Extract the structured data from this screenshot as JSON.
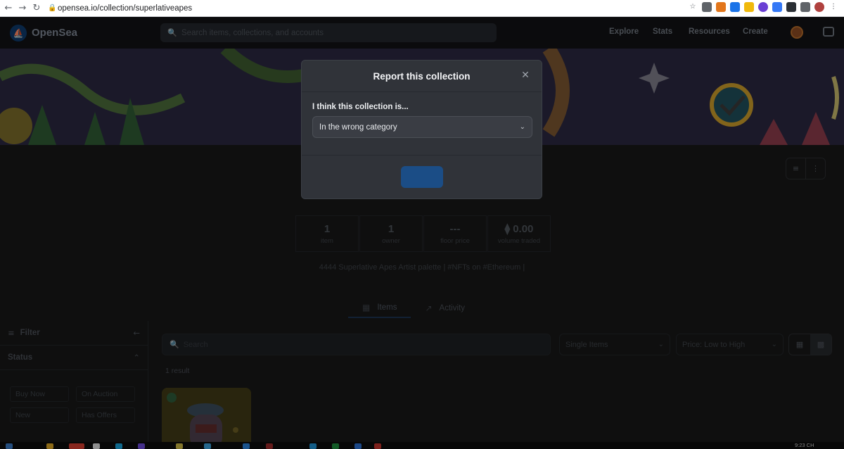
{
  "browser": {
    "url": "opensea.io/collection/superlativeapes",
    "back_glyph": "←",
    "forward_glyph": "→",
    "reload_glyph": "↻",
    "lock_glyph": "🔒",
    "star_glyph": "☆"
  },
  "header": {
    "brand": "OpenSea",
    "search_placeholder": "Search items, collections, and accounts",
    "nav": [
      "Explore",
      "Stats",
      "Resources",
      "Create"
    ]
  },
  "collection": {
    "stats": [
      {
        "value": "1",
        "label": "item"
      },
      {
        "value": "1",
        "label": "owner"
      },
      {
        "value": "---",
        "label": "floor price"
      },
      {
        "value": "⧫ 0.00",
        "label": "volume traded"
      }
    ],
    "description": "4444 Superlative Apes Artist palette | #NFTs on #Ethereum |",
    "tabs": [
      "Items",
      "Activity"
    ]
  },
  "filters": {
    "title": "Filter",
    "status_title": "Status",
    "chips": [
      "Buy Now",
      "On Auction",
      "New",
      "Has Offers"
    ]
  },
  "grid": {
    "search_placeholder": "Search",
    "type_select": "Single Items",
    "sort_select": "Price: Low to High",
    "result_count": "1 result"
  },
  "modal": {
    "title": "Report this collection",
    "close_glyph": "✕",
    "field_label": "I think this collection is...",
    "selected_option": "In the wrong category",
    "chevron_glyph": "⌄"
  },
  "taskbar": {
    "time": "9:23 CH"
  },
  "colors": {
    "modal_bg": "#303339",
    "accent_button": "#1b4d86",
    "page_bg": "#171717"
  }
}
